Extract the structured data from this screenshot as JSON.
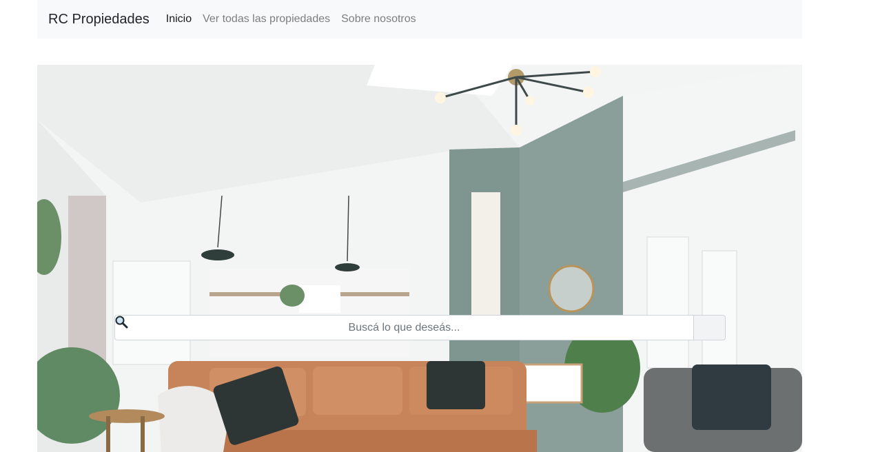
{
  "navbar": {
    "brand": "RC Propiedades",
    "links": [
      {
        "label": "Inicio",
        "active": true
      },
      {
        "label": "Ver todas las propiedades",
        "active": false
      },
      {
        "label": "Sobre nosotros",
        "active": false
      }
    ]
  },
  "hero": {
    "image_description_icon": "living-room-photo",
    "search": {
      "placeholder": "Buscá lo que deseás...",
      "value": "",
      "button_icon": "magnifier-icon"
    }
  },
  "colors": {
    "navbar_bg": "#f8f9fa",
    "accent_wall": "#7f9590",
    "sofa": "#c7845a"
  }
}
